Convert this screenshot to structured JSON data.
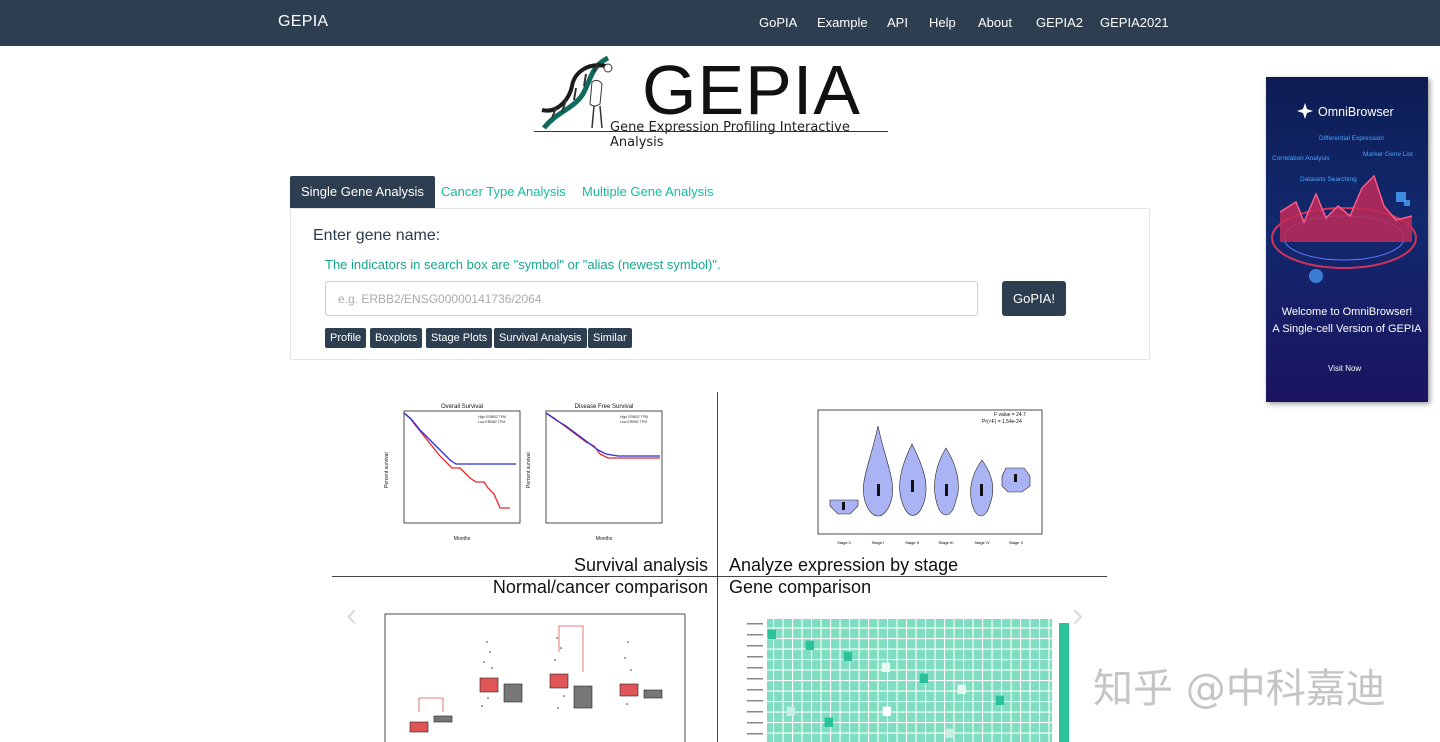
{
  "navbar": {
    "brand": "GEPIA",
    "links": [
      "GoPIA",
      "Example",
      "API",
      "Help",
      "About",
      "GEPIA2",
      "GEPIA2021"
    ]
  },
  "logo": {
    "title": "GEPIA",
    "subtitle": "Gene Expression Profiling Interactive Analysis"
  },
  "tabs": [
    "Single Gene Analysis",
    "Cancer Type Analysis",
    "Multiple Gene Analysis"
  ],
  "active_tab": "Single Gene Analysis",
  "search": {
    "label": "Enter gene name:",
    "hint": "The indicators in search box are \"symbol\" or \"alias (newest symbol)\".",
    "placeholder": "e.g. ERBB2/ENSG00000141736/2064",
    "value": "",
    "submit_label": "GoPIA!"
  },
  "quick_buttons": [
    "Profile",
    "Boxplots",
    "Stage Plots",
    "Survival Analysis",
    "Similar"
  ],
  "carousel": {
    "captions": [
      "Survival analysis",
      "Analyze expression by stage",
      "Normal/cancer comparison",
      "Gene comparison"
    ],
    "survival": {
      "titles": [
        "Overall Survival",
        "Disease Free Survival"
      ],
      "xlabel": "Months",
      "ylabel": "Percent survival",
      "legend_high": "High ERBB2 TPM",
      "legend_low": "Low ERBB2 TPM"
    },
    "stage": {
      "f_value": "F value = 24.7",
      "pr": "Pr(>F) = 1.54e-24",
      "categories": [
        "Stage 0",
        "Stage I",
        "Stage II",
        "Stage III",
        "Stage IV",
        "Stage X"
      ]
    },
    "colors": {
      "high": "#e8262a",
      "low": "#2c2cd8",
      "violin": "#aab4f5",
      "box_tumor": "#e05555",
      "box_normal": "#777777",
      "heat": "#2bc19a"
    }
  },
  "ad": {
    "brand": "OmniBrowser",
    "features": [
      "Differential Expression",
      "Correlation Analysis",
      "Marker Gene List",
      "Datasets Searching"
    ],
    "welcome_line1": "Welcome to OmniBrowser!",
    "welcome_line2": "A Single-cell Version of GEPIA",
    "cta": "Visit Now"
  },
  "watermark": "知乎 @中科嘉迪"
}
